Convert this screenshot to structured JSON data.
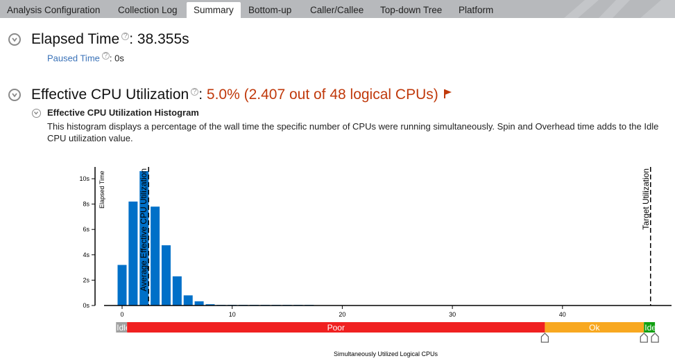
{
  "tabs": [
    {
      "label": "Analysis Configuration",
      "active": false
    },
    {
      "label": "Collection Log",
      "active": false
    },
    {
      "label": "Summary",
      "active": true
    },
    {
      "label": "Bottom-up",
      "active": false
    },
    {
      "label": "Caller/Callee",
      "active": false
    },
    {
      "label": "Top-down Tree",
      "active": false
    },
    {
      "label": "Platform",
      "active": false
    }
  ],
  "elapsed": {
    "label": "Elapsed Time",
    "sep": ":",
    "value": "38.355s",
    "help": "?"
  },
  "paused": {
    "label": "Paused Time",
    "sep": ":",
    "value": "0s",
    "help": "?"
  },
  "cpu": {
    "label": "Effective CPU Utilization",
    "sep": ":",
    "value": "5.0% (2.407 out of 48 logical CPUs)",
    "help": "?",
    "flag_icon": "flag-icon"
  },
  "histogram": {
    "title": "Effective CPU Utilization Histogram",
    "description": "This histogram displays a percentage of the wall time the specific number of CPUs were running simultaneously. Spin and Overhead time adds to the Idle CPU utilization value."
  },
  "colors": {
    "bar": "#0070c8",
    "poor": "#f02020",
    "ok": "#f8a820",
    "ideal": "#10a010",
    "idle": "#a0a0a0",
    "accent": "#c0390b"
  },
  "chart_data": {
    "type": "bar",
    "xlabel": "Simultaneously Utilized Logical CPUs",
    "ylabel": "Elapsed Time",
    "x": [
      0,
      1,
      2,
      3,
      4,
      5,
      6,
      7,
      8,
      9,
      10,
      11,
      12,
      13,
      14,
      15,
      16,
      17
    ],
    "values": [
      3.2,
      8.2,
      10.6,
      7.8,
      4.75,
      2.3,
      0.8,
      0.33,
      0.1,
      0.05,
      0.05,
      0.05,
      0.05,
      0.05,
      0.05,
      0.05,
      0.05,
      0.05
    ],
    "xticks": [
      {
        "v": 0,
        "label": "0"
      },
      {
        "v": 10,
        "label": "10"
      },
      {
        "v": 20,
        "label": "20"
      },
      {
        "v": 30,
        "label": "30"
      },
      {
        "v": 40,
        "label": "40"
      }
    ],
    "yticks": [
      {
        "v": 0,
        "label": "0s"
      },
      {
        "v": 2,
        "label": "2s"
      },
      {
        "v": 4,
        "label": "4s"
      },
      {
        "v": 6,
        "label": "6s"
      },
      {
        "v": 8,
        "label": "8s"
      },
      {
        "v": 10,
        "label": "10s"
      }
    ],
    "xlim": [
      -1.6,
      49.5
    ],
    "ylim": [
      0,
      11
    ],
    "markers": [
      {
        "label": "Average Effective CPU Utilization",
        "x": 2.407
      },
      {
        "label": "Target Utilization",
        "x": 48
      }
    ],
    "ranges": [
      {
        "label": "Idle",
        "from": -0.55,
        "to": 0.45,
        "color": "#a0a0a0"
      },
      {
        "label": "Poor",
        "from": 0.45,
        "to": 38.4,
        "color": "#f02020"
      },
      {
        "label": "Ok",
        "from": 38.4,
        "to": 47.4,
        "color": "#f8a820"
      },
      {
        "label": "Ide",
        "from": 47.4,
        "to": 48.4,
        "color": "#10a010"
      }
    ],
    "handles": [
      38.4,
      47.4,
      48.4
    ]
  }
}
